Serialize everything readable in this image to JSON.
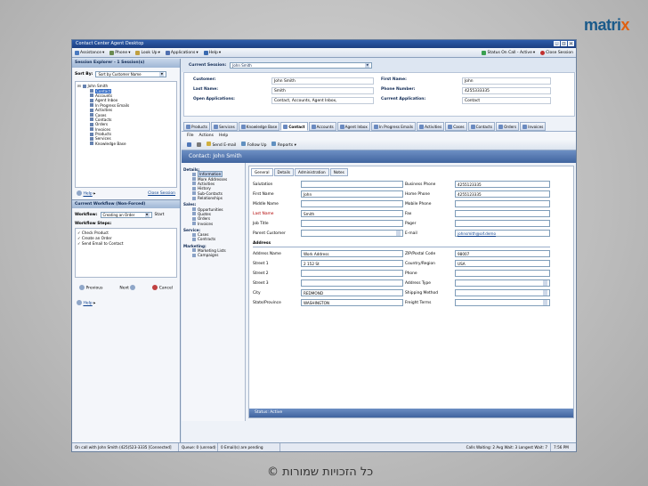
{
  "logo": {
    "text_main": "matri",
    "text_accent": "x"
  },
  "copyright": "© כל הזכויות שמורות",
  "window": {
    "title": "Contact Center Agent Desktop",
    "controls": [
      "_",
      "□",
      "x"
    ]
  },
  "toolbar": {
    "assistance": "Assistance",
    "phone": "Phone",
    "lookup": "Look Up",
    "applications": "Applications",
    "help": "Help",
    "status": "Status On Call - Active",
    "close_session": "Close Session"
  },
  "left": {
    "session_header": "Session Explorer - 1 Session(s)",
    "sort_label": "Sort By:",
    "sort_value": "Sort by Customer Name",
    "tree_root": "John Smith",
    "tree_items": [
      "Contact",
      "Accounts",
      "Agent Inbox",
      "In Progress Emails",
      "Activities",
      "Cases",
      "Contacts",
      "Orders",
      "Invoices",
      "Products",
      "Services",
      "Knowledge Base"
    ],
    "help": "Help",
    "close_session": "Close Session",
    "workflow_header": "Current Workflow (Non-Forced)",
    "workflow_label": "Workflow:",
    "workflow_value": "Creating an Order",
    "start": "Start",
    "steps_label": "Workflow Steps:",
    "steps": [
      "✓ Check Product",
      "✓ Create an Order",
      "✓ Send Email to Contact"
    ],
    "previous": "Previous",
    "next": "Next",
    "cancel": "Cancel",
    "help2": "Help"
  },
  "session": {
    "label": "Current Session:",
    "value": "John Smith"
  },
  "customer": {
    "customer_label": "Customer:",
    "customer_value": "John Smith",
    "first_name_label": "First Name:",
    "first_name_value": "John",
    "last_name_label": "Last Name:",
    "last_name_value": "Smith",
    "phone_label": "Phone Number:",
    "phone_value": "4255333335",
    "open_apps_label": "Open Applications:",
    "open_apps_value": "Contact, Accounts, Agent Inbox,",
    "current_app_label": "Current Application:",
    "current_app_value": "Contact"
  },
  "tabs": [
    "Products",
    "Services",
    "Knowledge Base",
    "Contact",
    "Accounts",
    "Agent Inbox",
    "In Progress Emails",
    "Activities",
    "Cases",
    "Contacts",
    "Orders",
    "Invoices"
  ],
  "menu": {
    "file": "File",
    "actions": "Actions",
    "help": "Help"
  },
  "formtoolbar": {
    "send_email": "Send E-mail",
    "follow_up": "Follow Up",
    "reports": "Reports"
  },
  "contact_title": "Contact: John Smith",
  "nav": {
    "details": "Details:",
    "details_items": [
      "Information",
      "More Addresses",
      "Activities",
      "History",
      "Sub-Contacts",
      "Relationships"
    ],
    "sales": "Sales:",
    "sales_items": [
      "Opportunities",
      "Quotes",
      "Orders",
      "Invoices"
    ],
    "service": "Service:",
    "service_items": [
      "Cases",
      "Contracts"
    ],
    "marketing": "Marketing:",
    "marketing_items": [
      "Marketing Lists",
      "Campaigns"
    ]
  },
  "form_tabs": [
    "General",
    "Details",
    "Administration",
    "Notes"
  ],
  "fields": {
    "salutation": "Salutation",
    "salutation_v": "",
    "business_phone": "Business Phone",
    "business_phone_v": "4255123335",
    "first_name": "First Name",
    "first_name_v": "John",
    "home_phone": "Home Phone",
    "home_phone_v": "4255123335",
    "middle_name": "Middle Name",
    "middle_name_v": "",
    "mobile_phone": "Mobile Phone",
    "mobile_phone_v": "",
    "last_name": "Last Name",
    "last_name_v": "Smith",
    "fax": "Fax",
    "fax_v": "",
    "job_title": "Job Title",
    "job_title_v": "",
    "pager": "Pager",
    "pager_v": "",
    "parent_customer": "Parent Customer",
    "parent_customer_v": "",
    "email": "E-mail",
    "email_v": "johnsmith@oif.demo",
    "address_section": "Address",
    "address_name": "Address Name",
    "address_name_v": "Work Address",
    "zip": "ZIP/Postal Code",
    "zip_v": "98007",
    "street1": "Street 1",
    "street1_v": "2 152 St",
    "country": "Country/Region",
    "country_v": "USA",
    "street2": "Street 2",
    "street2_v": "",
    "phone": "Phone",
    "phone_v": "",
    "street3": "Street 3",
    "street3_v": "",
    "address_type": "Address Type",
    "address_type_v": "",
    "city": "City",
    "city_v": "REDMOND",
    "shipping": "Shipping Method",
    "shipping_v": "",
    "state": "State/Province",
    "state_v": "WASHINGTON",
    "freight": "Freight Terms",
    "freight_v": ""
  },
  "status_active": "Status: Active",
  "winstatus": [
    "On call with John Smith (425)523-3335 [Connected]",
    "Queue: 0 (unread)",
    "0 Email(s) are pending",
    "Calls Waiting: 2  Avg Wait: 3  Longest Wait: 7",
    "7:56 PM"
  ]
}
